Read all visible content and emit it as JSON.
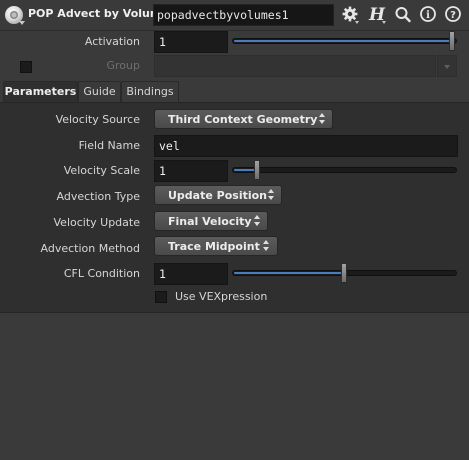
{
  "header": {
    "node_type": "POP Advect by Volumes",
    "node_name": "popadvectbyvolumes1",
    "icons": [
      "node-type-icon",
      "gear-icon",
      "houdini-help-h-icon",
      "search-icon",
      "info-icon",
      "help-icon"
    ]
  },
  "activation": {
    "label": "Activation",
    "value": "1",
    "level": 1.0
  },
  "group": {
    "label": "Group",
    "value": ""
  },
  "tabs": [
    {
      "label": "Parameters",
      "active": true
    },
    {
      "label": "Guide",
      "active": false
    },
    {
      "label": "Bindings",
      "active": false
    }
  ],
  "params": {
    "velocity_source": {
      "label": "Velocity Source",
      "value": "Third Context Geometry"
    },
    "field_name": {
      "label": "Field Name",
      "value": "vel"
    },
    "velocity_scale": {
      "label": "Velocity Scale",
      "value": "1",
      "level": 0.1
    },
    "advection_type": {
      "label": "Advection Type",
      "value": "Update Position"
    },
    "velocity_update": {
      "label": "Velocity Update",
      "value": "Final Velocity"
    },
    "advection_method": {
      "label": "Advection Method",
      "value": "Trace Midpoint"
    },
    "cfl_condition": {
      "label": "CFL Condition",
      "value": "1",
      "level": 0.5
    },
    "use_vexpression": {
      "label": "Use VEXpression",
      "checked": false
    }
  },
  "colors": {
    "accent": "#4a7cc0",
    "background": "#3a3a3a",
    "panel": "#2f2f2f",
    "field": "#1b1b1b"
  }
}
